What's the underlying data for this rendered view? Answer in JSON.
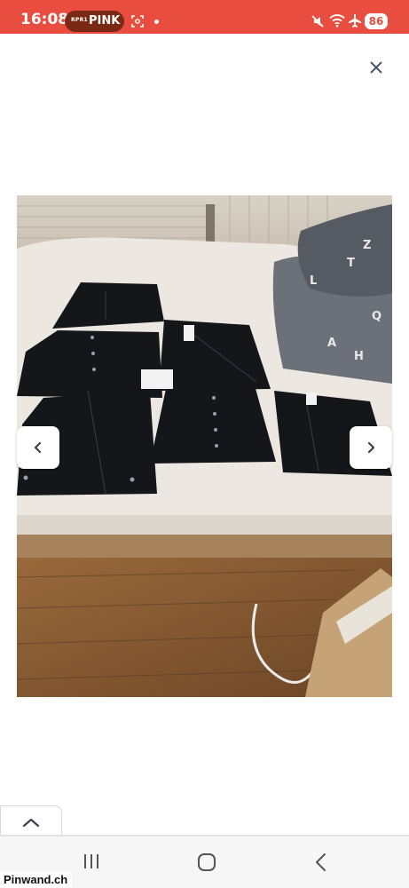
{
  "status_bar": {
    "time": "16:08",
    "station_tag": "RPR1",
    "station_name": "PINK",
    "battery": "86",
    "icons": [
      "screenshot-icon",
      "mute-icon",
      "wifi-icon",
      "airplane-icon"
    ]
  },
  "viewer": {
    "close_icon": "close-icon",
    "prev_icon": "chevron-left-icon",
    "next_icon": "chevron-right-icon",
    "photo_alt": "Schwarze Lederröcke auf einem Bett"
  },
  "drawer": {
    "icon": "chevron-up-icon"
  },
  "nav_bar": {
    "icons": [
      "recent-apps-icon",
      "home-icon",
      "back-icon"
    ]
  },
  "watermark": "Pinwand.ch",
  "colors": {
    "status_bar": "#e84d3f",
    "pill": "#7a2a14",
    "background": "#ffffff"
  }
}
